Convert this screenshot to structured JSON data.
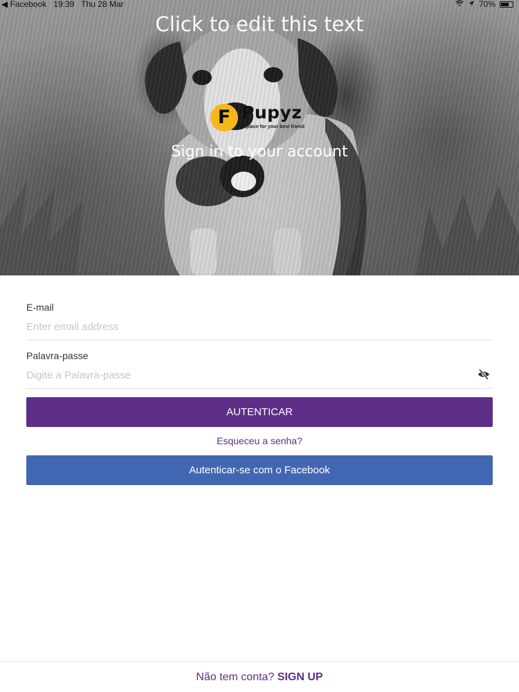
{
  "status_bar": {
    "back_app": "Facebook",
    "time": "19:39",
    "date": "Thu 28 Mar",
    "battery": "70%",
    "battery_level": 0.7
  },
  "hero": {
    "edit_text": "Click to edit this text",
    "logo": {
      "letter": "F",
      "name": "Pupyz",
      "tagline": "a place for your best friend"
    },
    "title": "Sign in to your account"
  },
  "form": {
    "email_label": "E-mail",
    "email_placeholder": "Enter email address",
    "password_label": "Palavra-passe",
    "password_placeholder": "Digite a Palavra-passe",
    "auth_button": "AUTENTICAR",
    "forgot_link": "Esqueceu a senha?",
    "facebook_button": "Autenticar-se com o Facebook"
  },
  "footer": {
    "question": "Não tem conta?",
    "signup": "SIGN UP"
  },
  "colors": {
    "primary": "#5d2e86",
    "facebook": "#4267b2",
    "logo_yellow": "#f5b81c"
  }
}
